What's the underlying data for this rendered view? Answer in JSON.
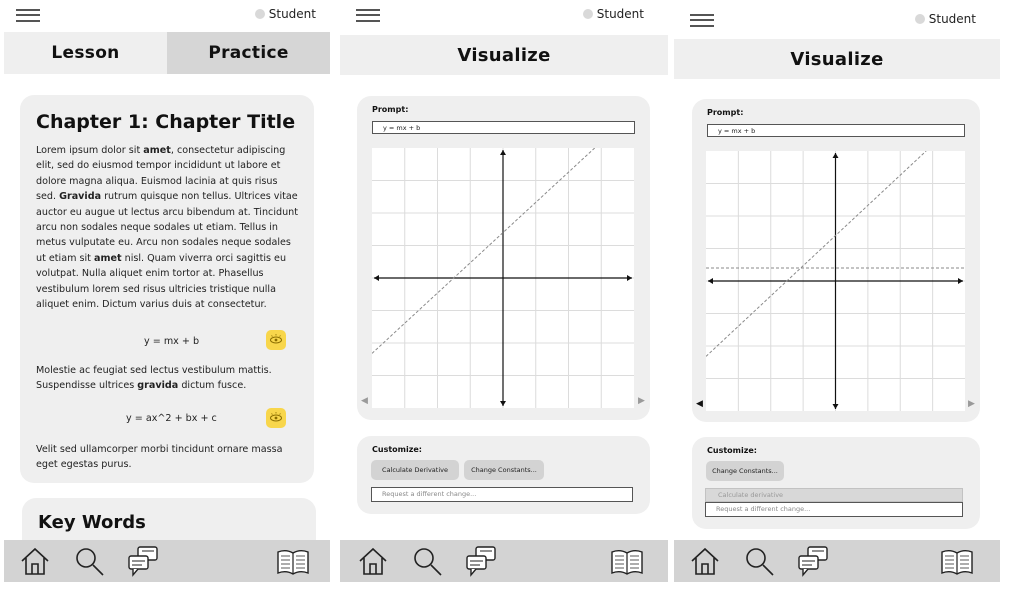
{
  "panel1": {
    "user": "Student",
    "tabs": [
      {
        "label": "Lesson"
      },
      {
        "label": "Practice"
      }
    ],
    "chapter_title": "Chapter 1: Chapter Title",
    "para1_segments": [
      "Lorem ipsum dolor sit ",
      "amet",
      ", consectetur adipiscing elit, sed do eiusmod tempor incididunt ut labore et dolore magna aliqua. Euismod lacinia at quis risus sed. ",
      "Gravida",
      " rutrum quisque non tellus. Ultrices vitae auctor eu augue ut lectus arcu bibendum at. Tincidunt arcu non sodales neque sodales ut etiam. Tellus in metus vulputate eu. Arcu non sodales neque sodales ut etiam sit ",
      "amet",
      " nisl. Quam viverra orci sagittis eu volutpat. Nulla aliquet enim tortor at. Phasellus vestibulum lorem sed risus ultricies tristique nulla aliquet enim. Dictum varius duis at consectetur."
    ],
    "equation1": "y = mx + b",
    "para2_segments": [
      "Molestie ac feugiat sed lectus vestibulum mattis. Suspendisse ultrices ",
      "gravida",
      " dictum fusce."
    ],
    "equation2": "y = ax^2 + bx + c",
    "para3": "Velit sed ullamcorper morbi tincidunt ornare massa eget egestas purus.",
    "key_words_title": "Key Words",
    "nav_icons": [
      "home-icon",
      "search-icon",
      "chat-icon",
      "book-icon"
    ]
  },
  "panel2": {
    "user": "Student",
    "header": "Visualize",
    "prompt_label": "Prompt:",
    "prompt_value": "y = mx + b",
    "customize_label": "Customize:",
    "chips": [
      {
        "label": "Calculate Derivative"
      },
      {
        "label": "Change Constants..."
      }
    ],
    "request_placeholder": "Request a different change..."
  },
  "panel3": {
    "user": "Student",
    "header": "Visualize",
    "prompt_label": "Prompt:",
    "prompt_value": "y = mx + b",
    "customize_label": "Customize:",
    "chip": "Change Constants...",
    "disabled_option": "Calculate derivative",
    "request_placeholder": "Request a different change..."
  },
  "colors": {
    "panel_bg": "#efefef",
    "tab_active": "#d6d6d6",
    "nav_bar": "#d3d3d3",
    "eye_button": "#f8d64b"
  }
}
